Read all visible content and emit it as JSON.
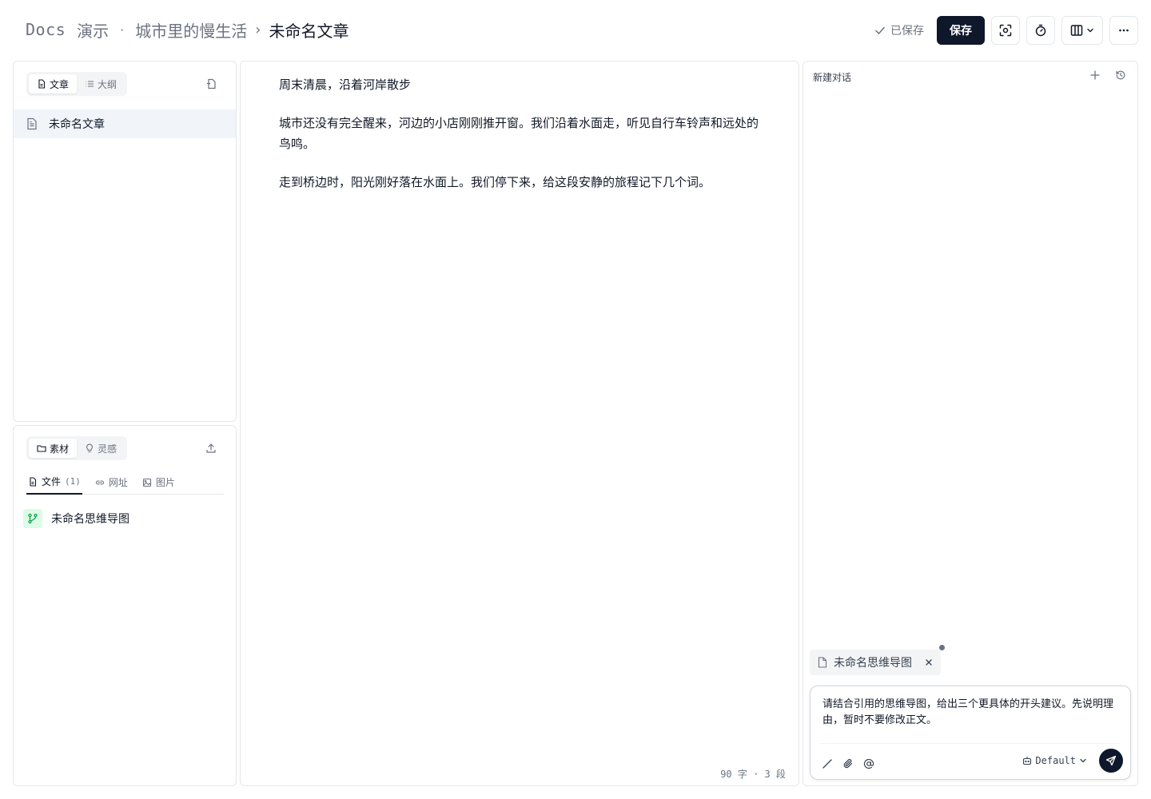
{
  "header": {
    "brand": "Docs",
    "workspace": "演示",
    "separator_dot": "·",
    "project": "城市里的慢生活",
    "separator": "›",
    "current": "未命名文章",
    "saved_status": "已保存",
    "save_label": "保存"
  },
  "articles_panel": {
    "tabs": [
      {
        "label": "文章",
        "icon": "file-icon",
        "active": true
      },
      {
        "label": "大纲",
        "icon": "list-icon",
        "active": false
      }
    ],
    "items": [
      {
        "title": "未命名文章",
        "icon": "document-icon",
        "selected": true
      }
    ]
  },
  "sources_panel": {
    "tabs": [
      {
        "label": "素材",
        "icon": "folder-icon",
        "active": true
      },
      {
        "label": "灵感",
        "icon": "lightbulb-icon",
        "active": false
      }
    ],
    "source_tabs": [
      {
        "label": "文件",
        "count": "(1)",
        "icon": "file-icon",
        "active": true
      },
      {
        "label": "网址",
        "icon": "link-icon",
        "active": false
      },
      {
        "label": "图片",
        "icon": "image-icon",
        "active": false
      }
    ],
    "files": [
      {
        "title": "未命名思维导图",
        "icon": "mindmap-icon"
      }
    ]
  },
  "editor": {
    "paragraphs": [
      "周末清晨，沿着河岸散步",
      "城市还没有完全醒来，河边的小店刚刚推开窗。我们沿着水面走，听见自行车铃声和远处的鸟鸣。",
      "走到桥边时，阳光刚好落在水面上。我们停下来，给这段安静的旅程记下几个词。"
    ],
    "stats": "90 字 · 3 段"
  },
  "chat": {
    "title": "新建对话",
    "attachment": "未命名思维导图",
    "message": "请结合引用的思维导图，给出三个更具体的开头建议。先说明理由，暂时不要修改正文。",
    "model": "Default"
  },
  "colors": {
    "primary": "#0f172a",
    "muted_text": "#6b7280",
    "border": "#e5e7eb",
    "selected_bg": "#f1f5f9",
    "mindmap_green": "#16a34a"
  }
}
